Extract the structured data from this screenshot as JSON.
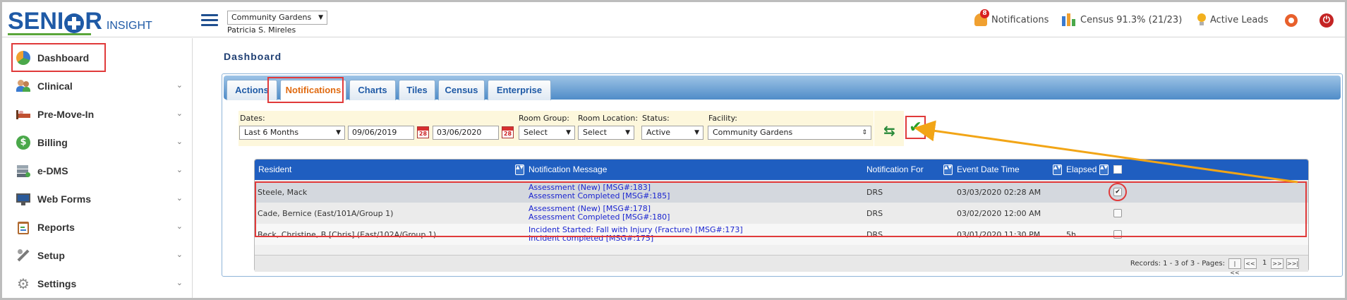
{
  "header": {
    "logo_main_left": "SENI",
    "logo_main_right": "R",
    "logo_sub": "INSIGHT",
    "facility_select": "Community Gardens",
    "user_name": "Patricia S. Mireles",
    "notifications_label": "Notifications",
    "notifications_badge": "8",
    "census_label": "Census 91.3% (21/23)",
    "active_leads_label": "Active Leads"
  },
  "sidebar": {
    "items": [
      {
        "label": "Dashboard",
        "icon": "pie-chart-icon"
      },
      {
        "label": "Clinical",
        "icon": "users-icon"
      },
      {
        "label": "Pre-Move-In",
        "icon": "bed-icon"
      },
      {
        "label": "Billing",
        "icon": "dollar-icon"
      },
      {
        "label": "e-DMS",
        "icon": "documents-icon"
      },
      {
        "label": "Web Forms",
        "icon": "monitor-icon"
      },
      {
        "label": "Reports",
        "icon": "clipboard-icon"
      },
      {
        "label": "Setup",
        "icon": "tools-icon"
      },
      {
        "label": "Settings",
        "icon": "gear-icon"
      }
    ]
  },
  "main": {
    "title": "Dashboard",
    "tabs": [
      {
        "label": "Actions"
      },
      {
        "label": "Notifications"
      },
      {
        "label": "Charts"
      },
      {
        "label": "Tiles"
      },
      {
        "label": "Census"
      },
      {
        "label": "Enterprise"
      }
    ],
    "filters": {
      "dates_label": "Dates:",
      "dates_value": "Last 6 Months",
      "from_date": "09/06/2019",
      "to_date": "03/06/2020",
      "cal_day": "28",
      "room_group_label": "Room Group:",
      "room_group_value": "Select",
      "room_location_label": "Room Location:",
      "room_location_value": "Select",
      "status_label": "Status:",
      "status_value": "Active",
      "facility_label": "Facility:",
      "facility_value": "Community Gardens"
    },
    "grid": {
      "columns": {
        "resident": "Resident",
        "message": "Notification Message",
        "for": "Notification For",
        "event": "Event Date Time",
        "elapsed": "Elapsed"
      },
      "rows": [
        {
          "resident": "Steele, Mack",
          "messages": [
            "Assessment (New) [MSG#:183]",
            "Assessment Completed [MSG#:185]"
          ],
          "for": "DRS",
          "event": "03/03/2020 02:28 AM",
          "elapsed": "",
          "checked": true
        },
        {
          "resident": "Cade, Bernice (East/101A/Group 1)",
          "messages": [
            "Assessment (New) [MSG#:178]",
            "Assessment Completed [MSG#:180]"
          ],
          "for": "DRS",
          "event": "03/02/2020 12:00 AM",
          "elapsed": "",
          "checked": false
        },
        {
          "resident": "Beck, Christine, B [Chris] (East/102A/Group 1)",
          "messages": [
            "Incident Started: Fall with Injury (Fracture) [MSG#:173]",
            "Incident completed [MSG#:175]"
          ],
          "for": "DRS",
          "event": "03/01/2020 11:30 PM",
          "elapsed": "5h",
          "checked": false
        }
      ],
      "records_text": "Records: 1 - 3 of 3 - Pages:",
      "page_num": "1"
    }
  },
  "colors": {
    "brand_blue": "#1f5aa6",
    "accent_orange": "#f0a030",
    "highlight_red": "#e03a3a",
    "link_blue": "#1a24d0"
  }
}
